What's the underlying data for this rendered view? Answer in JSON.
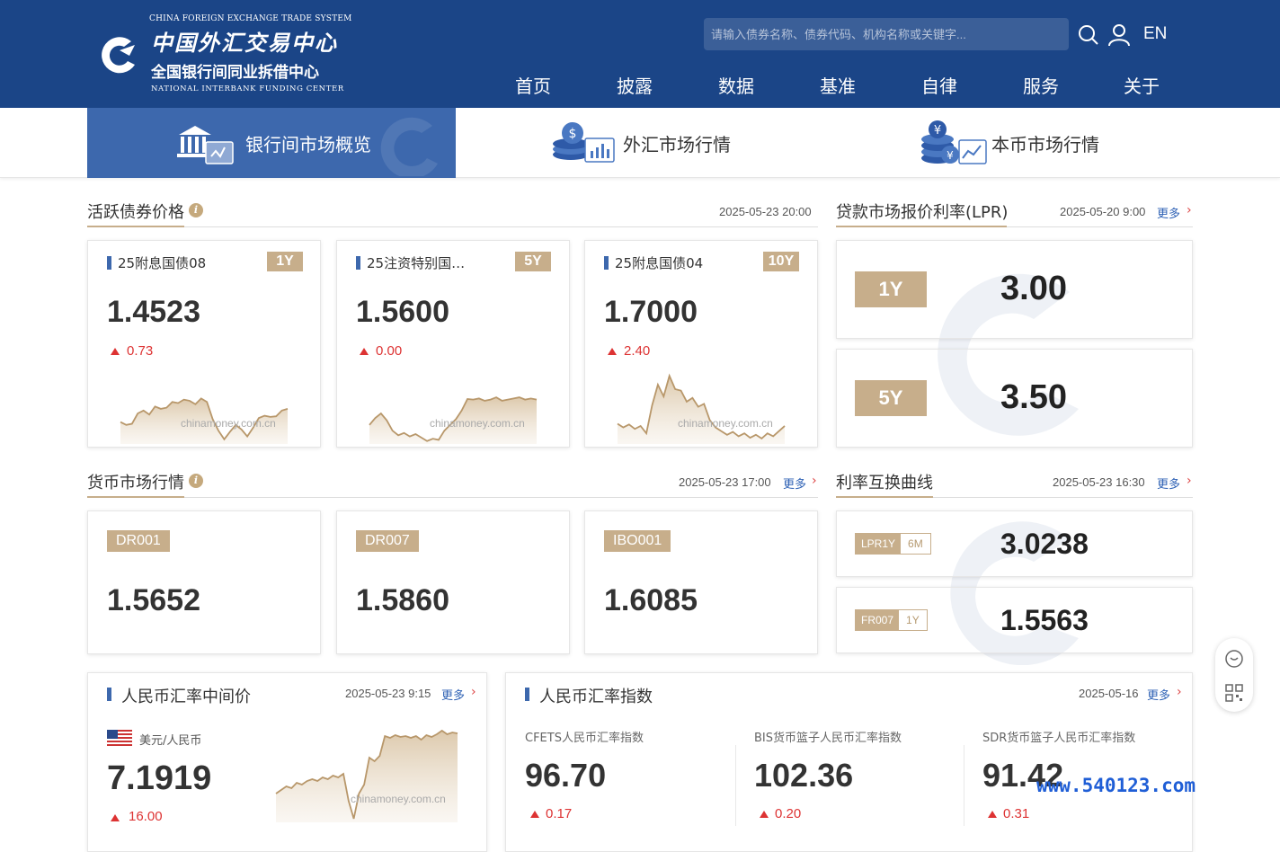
{
  "header": {
    "logo_top": "CHINA FOREIGN EXCHANGE TRADE SYSTEM",
    "logo_cn": "中国外汇交易中心",
    "logo_cn2": "全国银行间同业拆借中心",
    "logo_en": "NATIONAL INTERBANK FUNDING CENTER",
    "search_placeholder": "请输入债券名称、债券代码、机构名称或关键字...",
    "lang": "EN",
    "nav": [
      "首页",
      "披露",
      "数据",
      "基准",
      "自律",
      "服务",
      "关于"
    ]
  },
  "tabs": [
    {
      "label": "银行间市场概览",
      "active": true
    },
    {
      "label": "外汇市场行情",
      "active": false
    },
    {
      "label": "本币市场行情",
      "active": false
    }
  ],
  "bonds": {
    "title": "活跃债券价格",
    "date": "2025-05-23 20:00",
    "watermark": "chinamoney.com.cn",
    "items": [
      {
        "name": "25附息国债08",
        "tenor": "1Y",
        "value": "1.4523",
        "change": "0.73",
        "chart": [
          0.35,
          0.3,
          0.32,
          0.5,
          0.55,
          0.48,
          0.62,
          0.58,
          0.6,
          0.7,
          0.68,
          0.74,
          0.72,
          0.66,
          0.76,
          0.7,
          0.4,
          0.2,
          0.05,
          0.18,
          0.3,
          0.22,
          0.1,
          0.25,
          0.42,
          0.46,
          0.44,
          0.45,
          0.55,
          0.58
        ]
      },
      {
        "name": "25注资特别国…",
        "tenor": "5Y",
        "value": "1.5600",
        "change": "0.00",
        "chart": [
          0.3,
          0.42,
          0.5,
          0.38,
          0.2,
          0.12,
          0.16,
          0.1,
          0.14,
          0.08,
          0.02,
          0.06,
          0.04,
          0.2,
          0.3,
          0.4,
          0.55,
          0.75,
          0.74,
          0.76,
          0.72,
          0.74,
          0.78,
          0.72,
          0.74,
          0.76,
          0.78,
          0.74,
          0.76,
          0.74
        ]
      },
      {
        "name": "25附息国债04",
        "tenor": "10Y",
        "value": "1.7000",
        "change": "2.40",
        "chart": [
          0.25,
          0.2,
          0.24,
          0.18,
          0.22,
          0.12,
          0.5,
          0.78,
          0.62,
          0.9,
          0.72,
          0.7,
          0.55,
          0.6,
          0.48,
          0.52,
          0.3,
          0.2,
          0.15,
          0.1,
          0.14,
          0.08,
          0.12,
          0.06,
          0.1,
          0.05,
          0.12,
          0.08,
          0.15,
          0.22
        ]
      }
    ]
  },
  "lpr": {
    "title": "贷款市场报价利率(LPR)",
    "date": "2025-05-20 9:00",
    "more": "更多",
    "items": [
      {
        "tenor": "1Y",
        "value": "3.00"
      },
      {
        "tenor": "5Y",
        "value": "3.50"
      }
    ]
  },
  "money": {
    "title": "货币市场行情",
    "date": "2025-05-23 17:00",
    "more": "更多",
    "items": [
      {
        "name": "DR001",
        "value": "1.5652"
      },
      {
        "name": "DR007",
        "value": "1.5860"
      },
      {
        "name": "IBO001",
        "value": "1.6085"
      }
    ]
  },
  "swap": {
    "title": "利率互换曲线",
    "date": "2025-05-23 16:30",
    "more": "更多",
    "items": [
      {
        "name": "LPR1Y",
        "tenor": "6M",
        "value": "3.0238"
      },
      {
        "name": "FR007",
        "tenor": "1Y",
        "value": "1.5563"
      }
    ]
  },
  "fx": {
    "title": "人民币汇率中间价",
    "date": "2025-05-23 9:15",
    "more": "更多",
    "pair": "美元/人民币",
    "value": "7.1919",
    "change": "16.00",
    "watermark": "chinamoney.com.cn",
    "chart": [
      0.3,
      0.34,
      0.38,
      0.36,
      0.42,
      0.4,
      0.44,
      0.46,
      0.44,
      0.48,
      0.46,
      0.5,
      0.48,
      0.52,
      0.22,
      0.02,
      0.3,
      0.4,
      0.7,
      0.66,
      0.72,
      0.94,
      0.92,
      0.95,
      0.93,
      0.94,
      0.92,
      0.94,
      0.9,
      0.95,
      0.93,
      0.96,
      1.0,
      0.96,
      0.98,
      0.97
    ]
  },
  "index": {
    "title": "人民币汇率指数",
    "date": "2025-05-16",
    "more": "更多",
    "items": [
      {
        "label": "CFETS人民币汇率指数",
        "value": "96.70",
        "change": "0.17"
      },
      {
        "label": "BIS货币篮子人民币汇率指数",
        "value": "102.36",
        "change": "0.20"
      },
      {
        "label": "SDR货币篮子人民币汇率指数",
        "value": "91.42",
        "change": "0.31"
      }
    ]
  },
  "site_watermark": "www.540123.com",
  "colors": {
    "brand_blue": "#1b4587",
    "tab_active": "#3d68ad",
    "gold": "#c7ae8b",
    "up_red": "#d33"
  }
}
